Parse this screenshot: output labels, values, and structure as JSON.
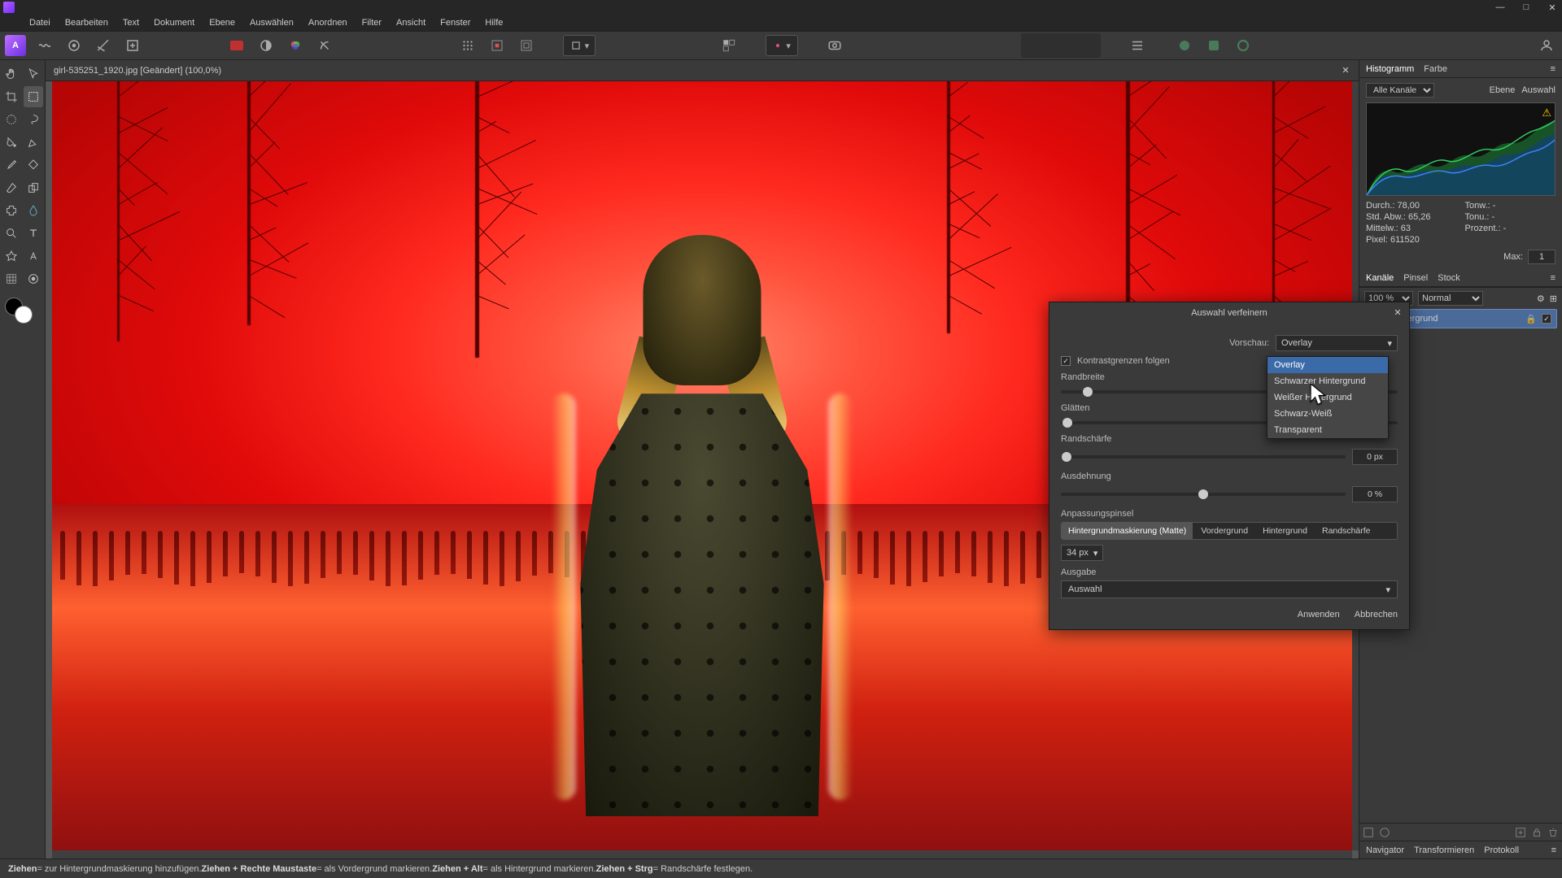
{
  "window": {
    "minimize": "—",
    "maximize": "□",
    "close": "✕"
  },
  "menu": [
    "Datei",
    "Bearbeiten",
    "Text",
    "Dokument",
    "Ebene",
    "Auswählen",
    "Anordnen",
    "Filter",
    "Ansicht",
    "Fenster",
    "Hilfe"
  ],
  "doc": {
    "title": "girl-535251_1920.jpg [Geändert] (100,0%)"
  },
  "hist": {
    "tabs": [
      "Histogramm",
      "Farbe"
    ],
    "channel": "Alle Kanäle",
    "ebene": "Ebene",
    "auswahl": "Auswahl",
    "stats": {
      "durch": "Durch.: 78,00",
      "tonw": "Tonw.: -",
      "std": "Std. Abw.: 65,26",
      "tonu": "Tonu.: -",
      "mittelw": "Mittelw.: 63",
      "prozent": "Prozent.: -",
      "pixel": "Pixel: 611520"
    },
    "max_label": "Max:",
    "max_val": "1"
  },
  "layertabs": [
    "Kanäle",
    "Pinsel",
    "Stock"
  ],
  "layers": {
    "opacity": "100 %",
    "blend": "Normal",
    "bg": "Hintergrund"
  },
  "dialog": {
    "title": "Auswahl verfeinern",
    "preview_label": "Vorschau:",
    "preview_value": "Overlay",
    "follow_edges": "Kontrastgrenzen folgen",
    "border": "Randbreite",
    "smooth": "Glätten",
    "feather": "Randschärfe",
    "feather_val": "0 px",
    "expand": "Ausdehnung",
    "expand_val": "0 %",
    "brush_label": "Anpassungspinsel",
    "brush_opts": [
      "Hintergrundmaskierung (Matte)",
      "Vordergrund",
      "Hintergrund",
      "Randschärfe"
    ],
    "brush_size": "34 px",
    "output_label": "Ausgabe",
    "output_value": "Auswahl",
    "apply": "Anwenden",
    "cancel": "Abbrechen"
  },
  "dropdown": [
    "Overlay",
    "Schwarzer Hintergrund",
    "Weißer Hintergrund",
    "Schwarz-Weiß",
    "Transparent"
  ],
  "bottomtabs": [
    "Navigator",
    "Transformieren",
    "Protokoll"
  ],
  "status": {
    "s1a": "Ziehen",
    "s1b": " = zur Hintergrundmaskierung hinzufügen. ",
    "s2a": "Ziehen + Rechte Maustaste",
    "s2b": " = als Vordergrund markieren. ",
    "s3a": "Ziehen + Alt",
    "s3b": " = als Hintergrund markieren. ",
    "s4a": "Ziehen + Strg",
    "s4b": " = Randschärfe festlegen."
  }
}
